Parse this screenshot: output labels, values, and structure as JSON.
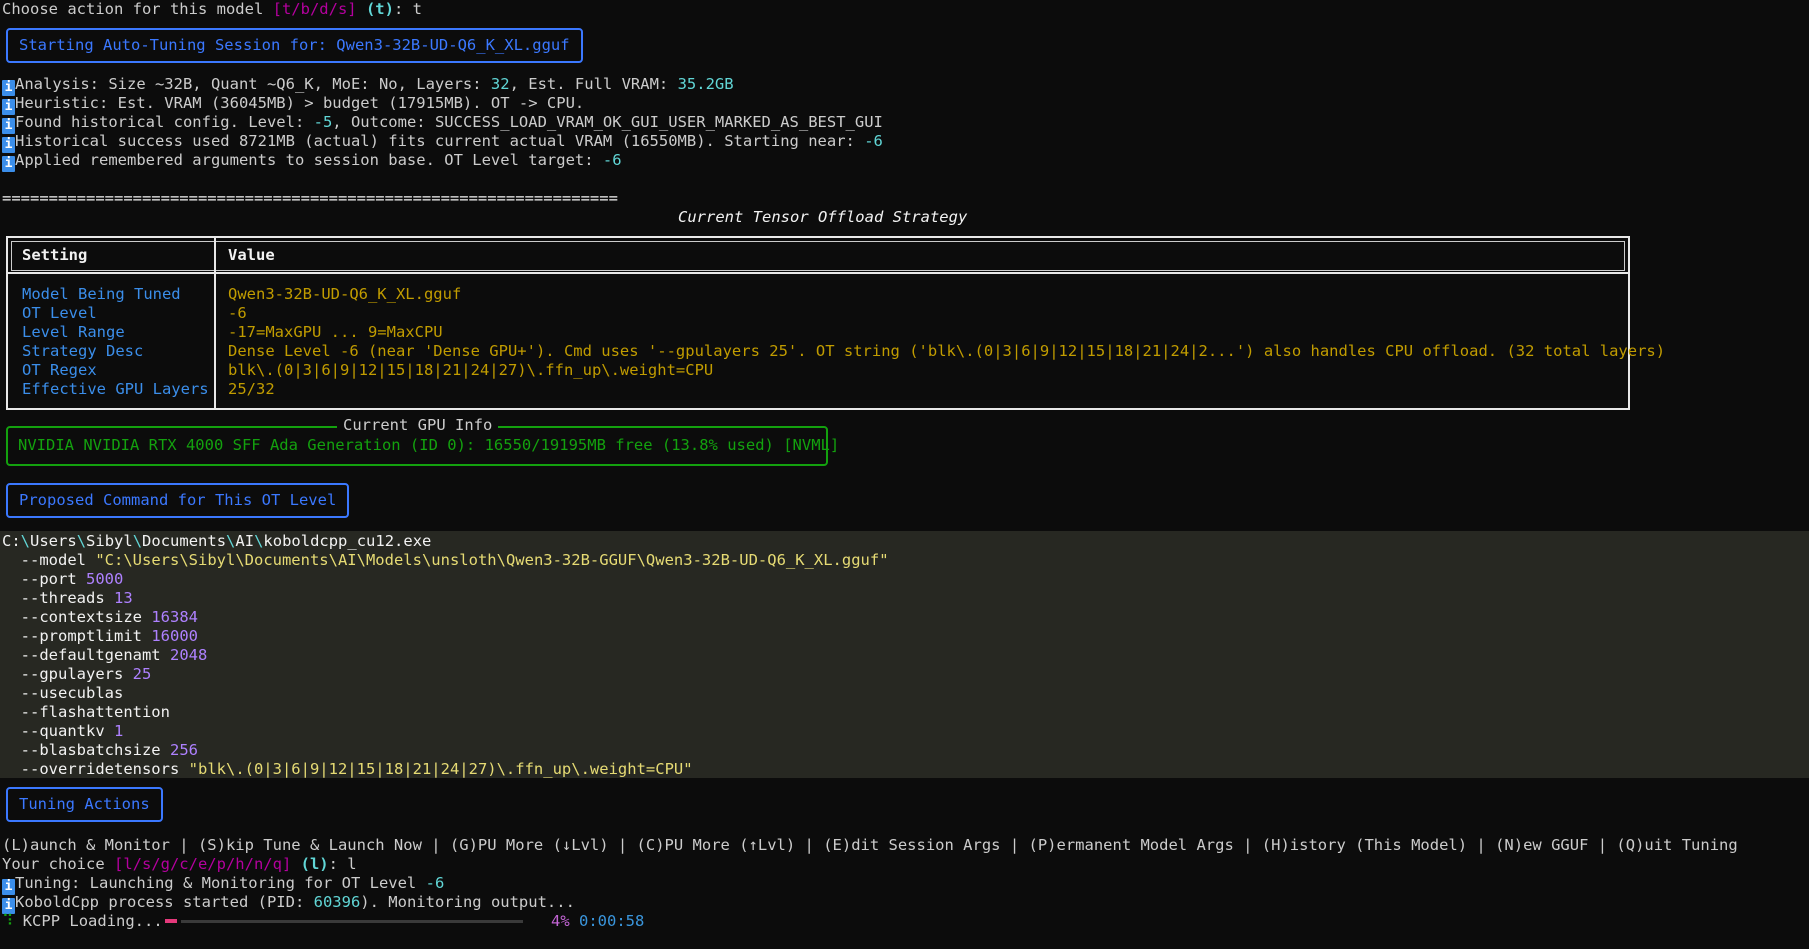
{
  "prompt_line": {
    "text": "Choose action for this model ",
    "options": "[t/b/d/s]",
    "default": "(t)",
    "answer": ": t"
  },
  "session_header": "Starting Auto-Tuning Session for: Qwen3-32B-UD-Q6_K_XL.gguf",
  "info_icon_glyph": "i",
  "info_lines": [
    {
      "pre": "Analysis: Size ~32B, Quant ~Q6_K, MoE: No, Layers: ",
      "hl1": "32",
      "mid": ", Est. Full VRAM: ",
      "hl2": "35.2GB"
    },
    {
      "pre": "Heuristic: Est. VRAM (36045MB) > budget (17915MB). OT -> CPU."
    },
    {
      "pre": "Found historical config. Level: ",
      "hl1": "-5",
      "mid": ", Outcome: SUCCESS_LOAD_VRAM_OK_GUI_USER_MARKED_AS_BEST_GUI"
    },
    {
      "pre": "Historical success used 8721MB (actual) fits current actual VRAM (16550MB). Starting near: ",
      "hl1": "-6"
    },
    {
      "pre": "Applied remembered arguments to session base. OT Level target: ",
      "hl1": "-6"
    }
  ],
  "separator": "==================================================================",
  "table": {
    "title": "Current Tensor Offload Strategy",
    "col_setting": "Setting",
    "col_value": "Value",
    "rows": [
      {
        "k": "Model Being Tuned",
        "v": "Qwen3-32B-UD-Q6_K_XL.gguf"
      },
      {
        "k": "OT Level",
        "v": "-6"
      },
      {
        "k": "Level Range",
        "v": "-17=MaxGPU ... 9=MaxCPU"
      },
      {
        "k": "Strategy Desc",
        "v": "Dense Level -6 (near 'Dense GPU+'). Cmd uses '--gpulayers 25'. OT string ('blk\\.(0|3|6|9|12|15|18|21|24|2...') also handles CPU offload. (32 total layers)"
      },
      {
        "k": "OT Regex",
        "v": "blk\\.(0|3|6|9|12|15|18|21|24|27)\\.ffn_up\\.weight=CPU"
      },
      {
        "k": "Effective GPU Layers",
        "v": "25/32"
      }
    ]
  },
  "gpu_info": {
    "title": "Current GPU Info",
    "text": "NVIDIA NVIDIA RTX 4000 SFF Ada Generation (ID 0): 16550/19195MB free (13.8% used) [NVML]"
  },
  "proposed_header": "Proposed Command for This OT Level",
  "command": {
    "exe_segments": [
      "C:",
      "\\",
      "Users",
      "\\",
      "Sibyl",
      "\\",
      "Documents",
      "\\",
      "AI",
      "\\",
      "koboldcpp_cu12.exe"
    ],
    "args": [
      {
        "flag": "--model",
        "val": "\"C:\\Users\\Sibyl\\Documents\\AI\\Models\\unsloth\\Qwen3-32B-GGUF\\Qwen3-32B-UD-Q6_K_XL.gguf\"",
        "kind": "str"
      },
      {
        "flag": "--port",
        "val": "5000",
        "kind": "num"
      },
      {
        "flag": "--threads",
        "val": "13",
        "kind": "num"
      },
      {
        "flag": "--contextsize",
        "val": "16384",
        "kind": "num"
      },
      {
        "flag": "--promptlimit",
        "val": "16000",
        "kind": "num"
      },
      {
        "flag": "--defaultgenamt",
        "val": "2048",
        "kind": "num"
      },
      {
        "flag": "--gpulayers",
        "val": "25",
        "kind": "num"
      },
      {
        "flag": "--usecublas",
        "val": "",
        "kind": "none"
      },
      {
        "flag": "--flashattention",
        "val": "",
        "kind": "none"
      },
      {
        "flag": "--quantkv",
        "val": "1",
        "kind": "num"
      },
      {
        "flag": "--blasbatchsize",
        "val": "256",
        "kind": "num"
      },
      {
        "flag": "--overridetensors",
        "val": "\"blk\\.(0|3|6|9|12|15|18|21|24|27)\\.ffn_up\\.weight=CPU\"",
        "kind": "str"
      }
    ]
  },
  "tuning_header": "Tuning Actions",
  "actions_line": "(L)aunch & Monitor | (S)kip Tune & Launch Now | (G)PU More (↓Lvl) | (C)PU More (↑Lvl) | (E)dit Session Args | (P)ermanent Model Args | (H)istory (This Model) | (N)ew GGUF | (Q)uit Tuning",
  "choice_line": {
    "text": "Your choice ",
    "options": "[l/s/g/c/e/p/h/n/q]",
    "default": "(l)",
    "answer": ": l"
  },
  "status_lines": [
    {
      "pre": "Tuning: Launching & Monitoring for OT Level ",
      "hl": "-6",
      "post": ""
    },
    {
      "pre": "KoboldCpp process started (PID: ",
      "hl": "60396",
      "post": "). Monitoring output..."
    }
  ],
  "loading": {
    "spinner": "⠹",
    "label": "KCPP Loading...",
    "progress_fraction": 0.04,
    "percent": "4%",
    "elapsed": "0:00:58"
  }
}
